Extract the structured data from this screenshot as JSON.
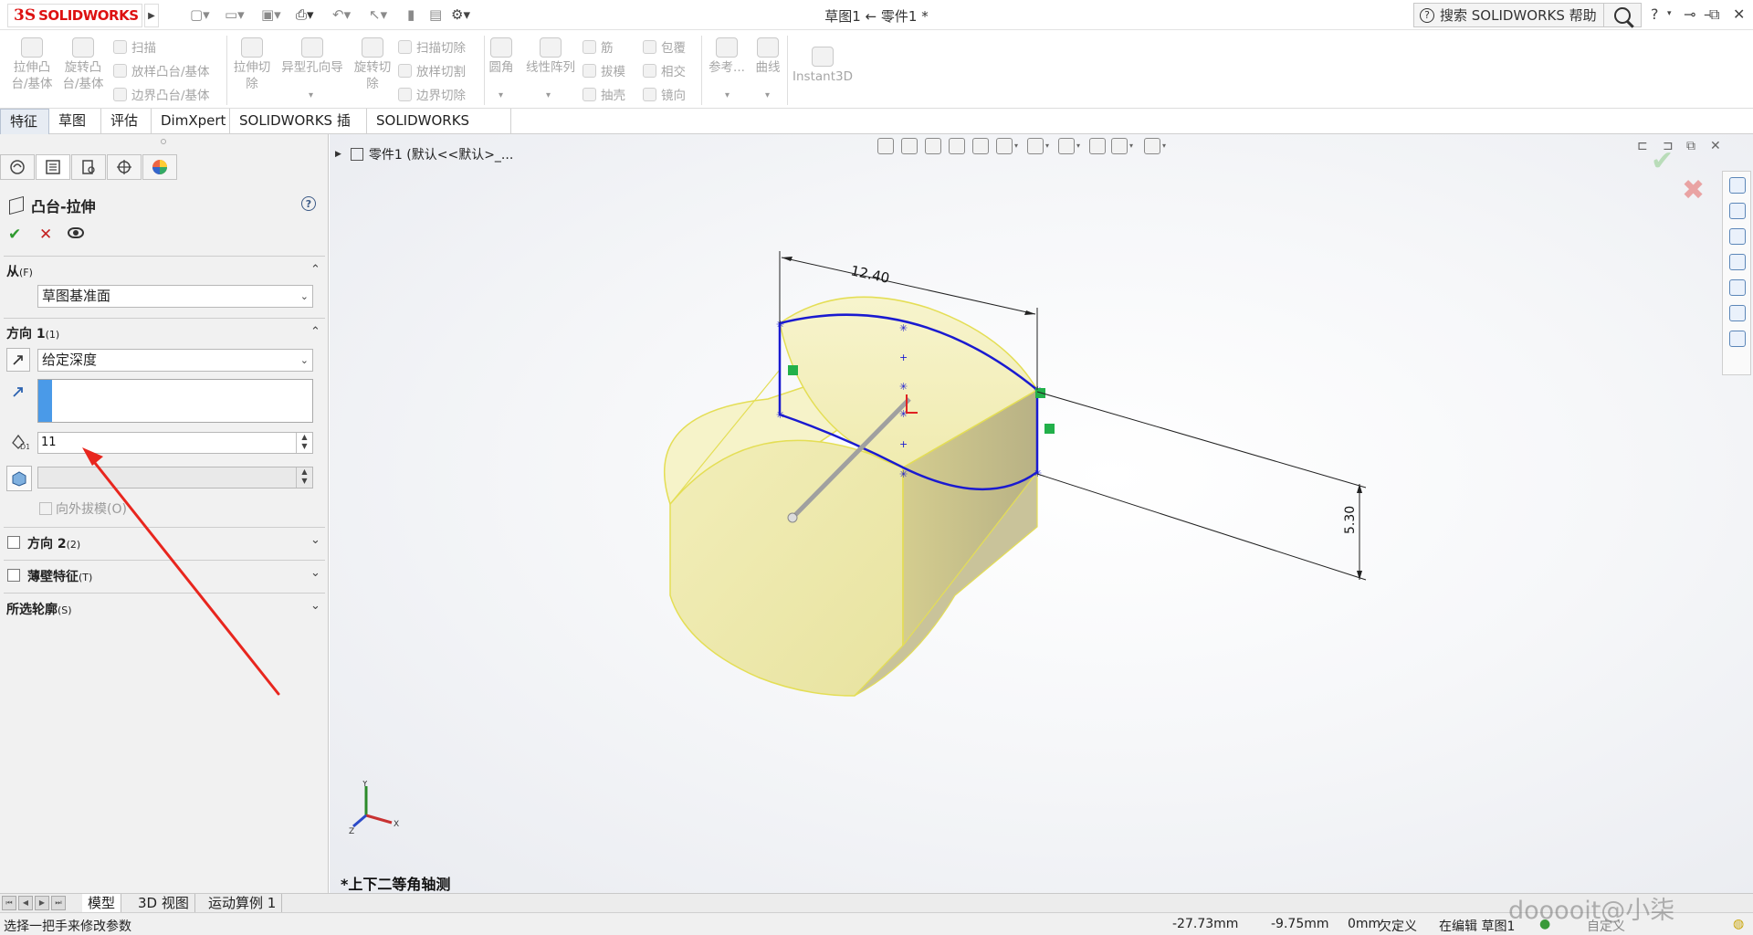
{
  "app": {
    "logo_prefix": "3S",
    "logo_text": "SOLIDWORKS",
    "doc_title": "草图1 ← 零件1 *",
    "search_placeholder": "搜索 SOLIDWORKS 帮助",
    "help_label": "?"
  },
  "ribbon": {
    "big": [
      {
        "label_1": "拉伸凸",
        "label_2": "台/基体"
      },
      {
        "label_1": "旋转凸",
        "label_2": "台/基体"
      },
      {
        "label_1": "拉伸切",
        "label_2": "除"
      },
      {
        "label_1": "异型孔向导",
        "label_2": ""
      },
      {
        "label_1": "旋转切",
        "label_2": "除"
      },
      {
        "label_1": "圆角",
        "label_2": ""
      },
      {
        "label_1": "线性阵列",
        "label_2": ""
      },
      {
        "label_1": "参考...",
        "label_2": ""
      },
      {
        "label_1": "曲线",
        "label_2": ""
      },
      {
        "label_1": "Instant3D",
        "label_2": ""
      }
    ],
    "small": {
      "sweep": "扫描",
      "loft": "放样凸台/基体",
      "boundary": "边界凸台/基体",
      "sweep_cut": "扫描切除",
      "loft_cut": "放样切割",
      "boundary_cut": "边界切除",
      "rib": "筋",
      "draft": "拔模",
      "shell": "抽壳",
      "wrap": "包覆",
      "intersect": "相交",
      "mirror": "镜向"
    }
  },
  "tabs": [
    "特征",
    "草图",
    "评估",
    "DimXpert",
    "SOLIDWORKS 插件",
    "SOLIDWORKS MBD"
  ],
  "property_manager": {
    "title": "凸台-拉伸",
    "from_label": "从",
    "from_key": "(F)",
    "from_value": "草图基准面",
    "dir1_label": "方向 1",
    "dir1_key": "(1)",
    "end_condition": "给定深度",
    "depth": "11",
    "draft_outward": "向外拔模(O)",
    "dir2_label": "方向 2",
    "dir2_key": "(2)",
    "thin_label": "薄壁特征",
    "thin_key": "(T)",
    "contours_label": "所选轮廓",
    "contours_key": "(S)"
  },
  "viewport": {
    "tree_item": "零件1 (默认<<默认>_...",
    "dim_width": "12.40",
    "dim_height": "5.30",
    "view_name": "*上下二等角轴测",
    "colors": {
      "sketch": "#1a1ad0",
      "body": "#f3efa8",
      "body_edge": "#e6e04a",
      "relation": "#22b04a"
    }
  },
  "bottom_tabs": [
    "模型",
    "3D 视图",
    "运动算例 1"
  ],
  "status": {
    "message": "选择一把手来修改参数",
    "x": "-27.73mm",
    "y": "-9.75mm",
    "z": "0mm",
    "state": "欠定义",
    "editing": "在编辑 草图1",
    "custom": "自定义"
  },
  "watermark": "dooooit@小柒"
}
